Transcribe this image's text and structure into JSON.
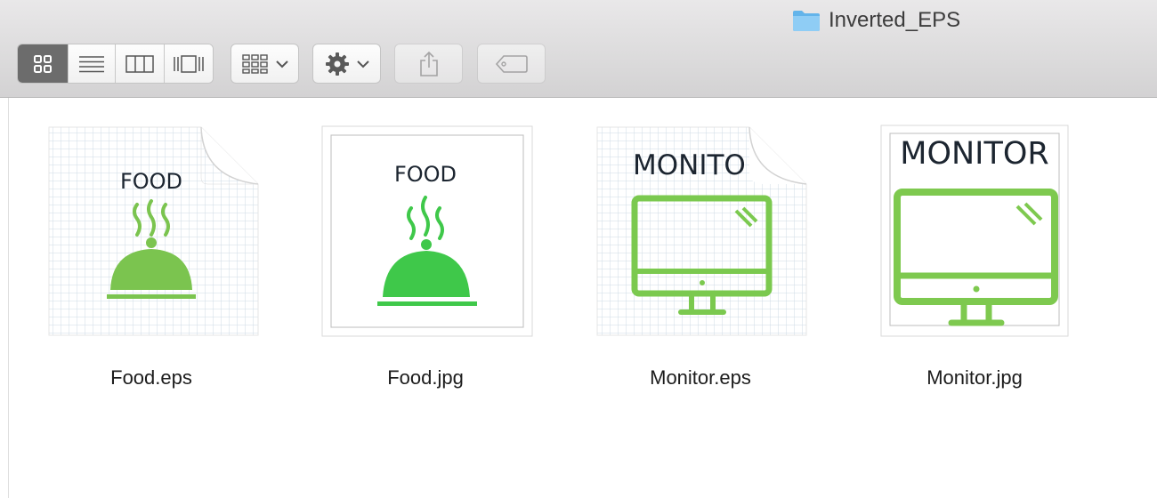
{
  "window": {
    "title": "Inverted_EPS"
  },
  "toolbar": {
    "view_modes": [
      "icon-view",
      "list-view",
      "column-view",
      "cover-flow-view"
    ],
    "active_view": "icon-view",
    "arrange_icon": "arrange-grid-icon",
    "action_icon": "gear-icon",
    "share_icon": "share-icon",
    "tag_icon": "tag-icon"
  },
  "files": [
    {
      "name": "Food.eps",
      "type": "eps",
      "thumb_text": "FOOD",
      "graphic": "food-cloche-icon",
      "color": "#7bc44f"
    },
    {
      "name": "Food.jpg",
      "type": "jpg",
      "thumb_text": "FOOD",
      "graphic": "food-cloche-icon",
      "color": "#3fc84a"
    },
    {
      "name": "Monitor.eps",
      "type": "eps",
      "thumb_text": "MONITO",
      "graphic": "monitor-icon",
      "color": "#7bc94f"
    },
    {
      "name": "Monitor.jpg",
      "type": "jpg",
      "thumb_text": "MONITOR",
      "graphic": "monitor-icon",
      "color": "#7ec94f"
    }
  ],
  "colors": {
    "folder": "#7cc2f0",
    "text_dark": "#1c2530",
    "toolbar_active": "#6c6c6c"
  }
}
